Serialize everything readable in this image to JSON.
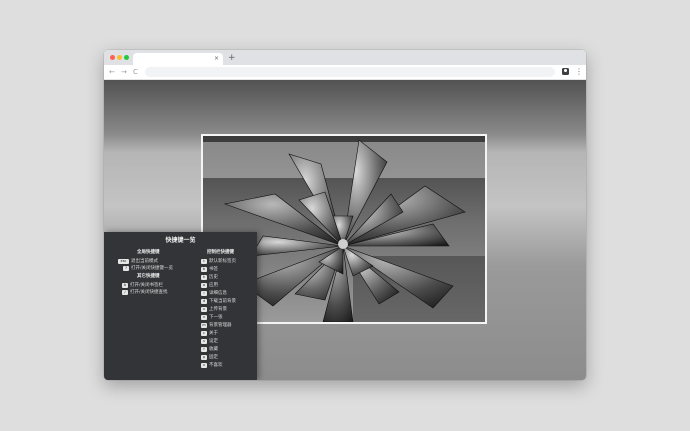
{
  "browser": {
    "tab_close": "×",
    "new_tab": "+",
    "back": "←",
    "forward": "→",
    "reload": "C",
    "menu": "⋮"
  },
  "shortcuts": {
    "title": "快捷键一览",
    "global_heading": "全局快捷键",
    "global": [
      {
        "key": "esc",
        "label": "退出当前模式"
      },
      {
        "key": "?",
        "label": "打开/关闭快捷键一览"
      }
    ],
    "other_heading": "其它快捷键",
    "other": [
      {
        "key": "b",
        "label": "打开/关闭书签栏"
      },
      {
        "key": "/",
        "label": "打开/关闭快捷查找"
      }
    ],
    "control_heading": "控制栏快捷键",
    "control": [
      {
        "key": "t",
        "label": "默认新标签页"
      },
      {
        "key": "b",
        "label": "书签"
      },
      {
        "key": "h",
        "label": "历史"
      },
      {
        "key": "a",
        "label": "应用"
      },
      {
        "key": "i",
        "label": "详细信息"
      },
      {
        "key": "d",
        "label": "下载当前背景"
      },
      {
        "key": "u",
        "label": "上传背景"
      },
      {
        "key": "n",
        "label": "下一张"
      },
      {
        "key": "m",
        "label": "背景管理器"
      },
      {
        "key": "c",
        "label": "关于"
      },
      {
        "key": "s",
        "label": "设定"
      },
      {
        "key": "f",
        "label": "收藏"
      },
      {
        "key": "p",
        "label": "固定"
      },
      {
        "key": "x",
        "label": "不喜欢"
      }
    ]
  }
}
